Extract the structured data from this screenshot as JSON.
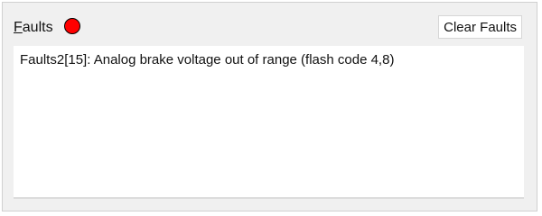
{
  "header": {
    "title_mnemonic": "F",
    "title_rest": "aults",
    "status_color": "#ff0000",
    "status": "fault-active",
    "clear_button_label": "Clear Faults"
  },
  "faults": {
    "items": [
      "Faults2[15]: Analog brake voltage out of range (flash code 4,8)"
    ]
  }
}
